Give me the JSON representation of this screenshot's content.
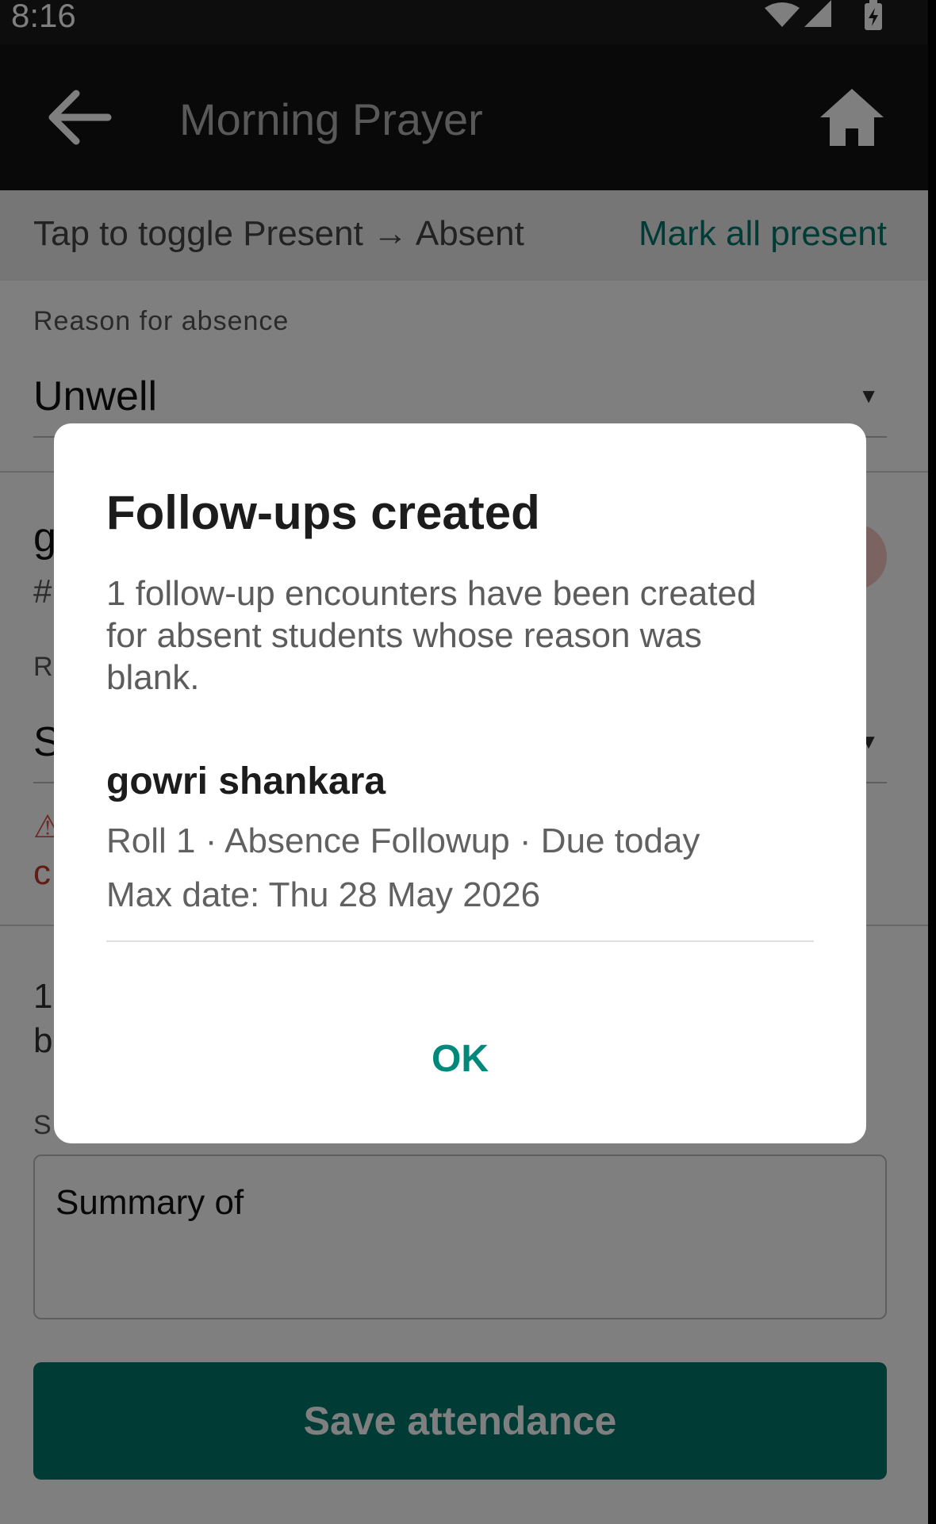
{
  "status_bar": {
    "time": "8:16",
    "icons": [
      "wifi-icon",
      "signal-icon",
      "battery-charging-icon"
    ]
  },
  "app_bar": {
    "title": "Morning Prayer",
    "back_icon": "arrow-back-icon",
    "home_icon": "home-icon"
  },
  "toggle_bar": {
    "hint": "Tap to toggle Present → Absent",
    "mark_all_label": "Mark all present"
  },
  "reason_section": {
    "label": "Reason for absence",
    "value": "Unwell"
  },
  "student": {
    "name_partial": "g",
    "roll_partial": "#",
    "reason_label_partial": "R",
    "reason_value_partial": "S",
    "warning_partial": "c"
  },
  "status_text": {
    "line1_partial": "1",
    "line2_partial": "b"
  },
  "summary": {
    "label_partial": "S",
    "value": "Summary of"
  },
  "save_button_label": "Save attendance",
  "dialog": {
    "title": "Follow-ups created",
    "message": "1 follow-up encounters have been created for absent students whose reason was blank.",
    "followup": {
      "name": "gowri shankara",
      "meta": "Roll 1 · Absence Followup · Due today",
      "max_date": "Max date: Thu 28 May 2026"
    },
    "ok_label": "OK"
  },
  "colors": {
    "accent": "#00796b",
    "ok_text": "#00897b",
    "warning": "#c0392b"
  }
}
